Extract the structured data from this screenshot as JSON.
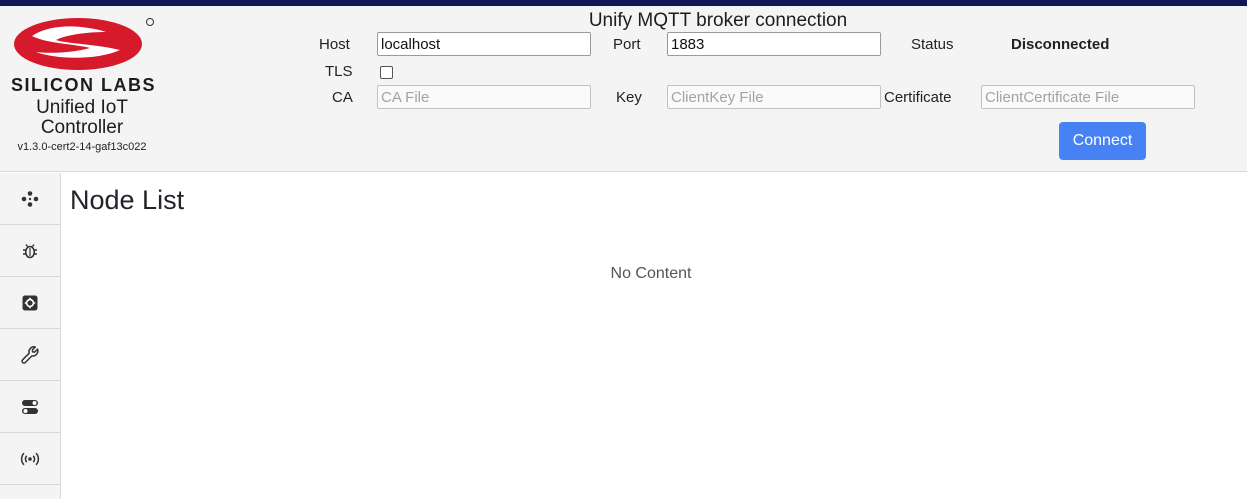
{
  "brand": {
    "logo_text": "SILICON LABS",
    "app_name_line1": "Unified IoT",
    "app_name_line2": "Controller",
    "version": "v1.3.0-cert2-14-gaf13c022"
  },
  "connection": {
    "title": "Unify MQTT broker connection",
    "host_label": "Host",
    "host_value": "localhost",
    "port_label": "Port",
    "port_value": "1883",
    "status_label": "Status",
    "status_value": "Disconnected",
    "tls_label": "TLS",
    "tls_checked": false,
    "ca_label": "CA",
    "ca_placeholder": "CA File",
    "key_label": "Key",
    "key_placeholder": "ClientKey File",
    "certificate_label": "Certificate",
    "certificate_placeholder": "ClientCertificate File",
    "connect_label": "Connect"
  },
  "sidebar": {
    "items": [
      {
        "icon": "network-nodes-icon"
      },
      {
        "icon": "bug-icon"
      },
      {
        "icon": "settings-gear-icon"
      },
      {
        "icon": "wrench-icon"
      },
      {
        "icon": "toggles-icon"
      },
      {
        "icon": "broadcast-icon"
      }
    ]
  },
  "main": {
    "title": "Node List",
    "empty_text": "No Content"
  },
  "colors": {
    "topbar": "#121557",
    "logo_red": "#d6192b",
    "connect_button": "#4682f4",
    "header_bg": "#f4f4f4"
  }
}
